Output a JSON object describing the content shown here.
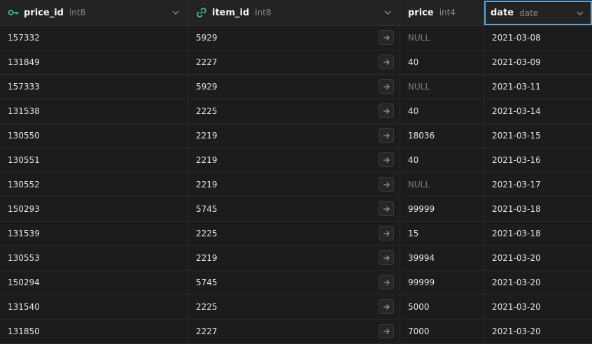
{
  "columns": [
    {
      "name": "price_id",
      "type": "int8",
      "icon": "key-icon"
    },
    {
      "name": "item_id",
      "type": "int8",
      "icon": "link-icon"
    },
    {
      "name": "price",
      "type": "int4"
    },
    {
      "name": "date",
      "type": "date"
    }
  ],
  "rows": [
    {
      "price_id": "157332",
      "item_id": "5929",
      "price": "NULL",
      "date": "2021-03-08"
    },
    {
      "price_id": "131849",
      "item_id": "2227",
      "price": "40",
      "date": "2021-03-09"
    },
    {
      "price_id": "157333",
      "item_id": "5929",
      "price": "NULL",
      "date": "2021-03-11"
    },
    {
      "price_id": "131538",
      "item_id": "2225",
      "price": "40",
      "date": "2021-03-14"
    },
    {
      "price_id": "130550",
      "item_id": "2219",
      "price": "18036",
      "date": "2021-03-15"
    },
    {
      "price_id": "130551",
      "item_id": "2219",
      "price": "40",
      "date": "2021-03-16"
    },
    {
      "price_id": "130552",
      "item_id": "2219",
      "price": "NULL",
      "date": "2021-03-17"
    },
    {
      "price_id": "150293",
      "item_id": "5745",
      "price": "99999",
      "date": "2021-03-18"
    },
    {
      "price_id": "131539",
      "item_id": "2225",
      "price": "15",
      "date": "2021-03-18"
    },
    {
      "price_id": "130553",
      "item_id": "2219",
      "price": "39994",
      "date": "2021-03-20"
    },
    {
      "price_id": "150294",
      "item_id": "5745",
      "price": "99999",
      "date": "2021-03-20"
    },
    {
      "price_id": "131540",
      "item_id": "2225",
      "price": "5000",
      "date": "2021-03-20"
    },
    {
      "price_id": "131850",
      "item_id": "2227",
      "price": "7000",
      "date": "2021-03-20"
    }
  ],
  "colors": {
    "background": "#1c1c1c",
    "key_icon": "#3ecf8e",
    "selected_outline": "#5ea5d9",
    "null_text": "#7d7d7d"
  }
}
